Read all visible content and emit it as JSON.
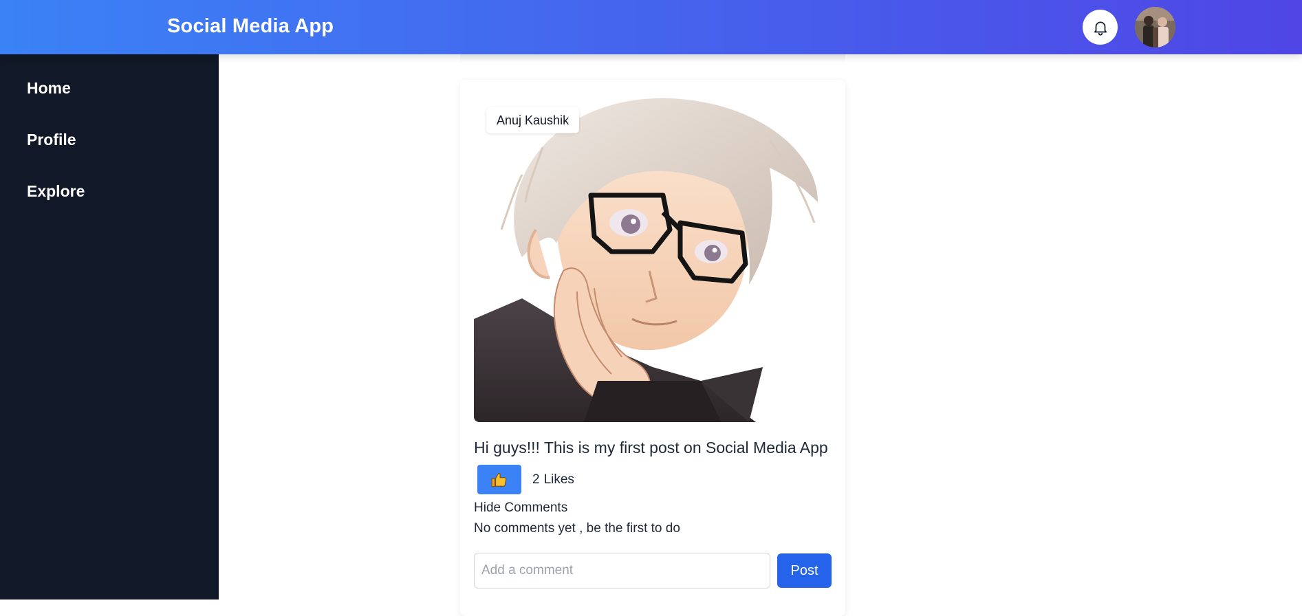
{
  "header": {
    "title": "Social Media App",
    "notification_icon": "bell-icon",
    "avatar_icon": "user-avatar"
  },
  "sidebar": {
    "items": [
      {
        "label": "Home"
      },
      {
        "label": "Profile"
      },
      {
        "label": "Explore"
      }
    ]
  },
  "post": {
    "author": "Anuj Kaushik",
    "text": "Hi guys!!! This is my first post on Social Media App",
    "like_icon": "thumbs-up-icon",
    "likes_count": "2",
    "likes_label": "Likes",
    "toggle_comments": "Hide Comments",
    "no_comments": "No comments yet , be the first to do",
    "comment_placeholder": "Add a comment",
    "post_button": "Post"
  },
  "colors": {
    "header_gradient_start": "#3b82f6",
    "header_gradient_end": "#4f46e5",
    "sidebar_bg": "#111827",
    "like_button": "#3b82f6",
    "post_button": "#2563eb"
  }
}
